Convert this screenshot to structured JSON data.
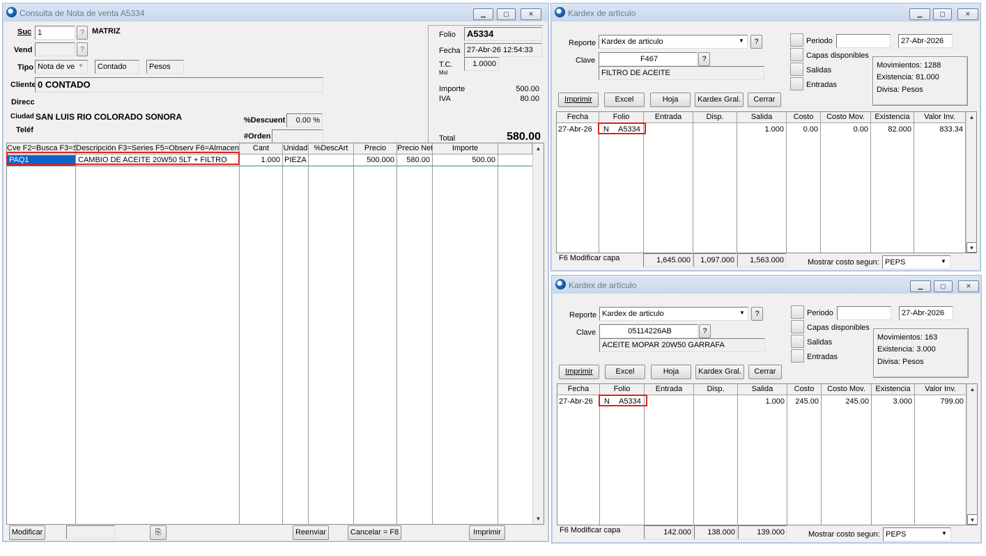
{
  "venta": {
    "title": "Consulta de Nota de venta A5334",
    "suc_label": "Suc",
    "suc_value": "1",
    "suc_name": "MATRIZ",
    "vend_label": "Vend",
    "tipo_label": "Tipo",
    "tipo_value": "Nota de ve",
    "tipo_contado": "Contado",
    "tipo_moneda": "Pesos",
    "cliente_label": "Cliente",
    "cliente_value": "0 CONTADO",
    "direcc_label": "Direcc",
    "ciudad_label": "Ciudad",
    "ciudad_value": "SAN LUIS RIO COLORADO SONORA",
    "telef_label": "Teléf",
    "descuent_label": "%Descuent",
    "descuent_value": "0.00 %",
    "orden_label": "#Orden",
    "folio_label": "Folio",
    "folio_value": "A5334",
    "fecha_label": "Fecha",
    "fecha_value": "27-Abr-26 12:54:33",
    "tc_label": "T.C.",
    "tc_sub": "Msl",
    "tc_value": "1.0000",
    "importe_label": "Importe",
    "importe_value": "500.00",
    "iva_label": "IVA",
    "iva_value": "80.00",
    "total_label": "Total",
    "total_value": "580.00",
    "help": "?",
    "columns": [
      "Cve F2=Busca F3=S",
      "Descripción  F3=Series F5=Observ F6=Almacen",
      "Cant",
      "Unidad",
      "%DescArt",
      "Precio",
      "Precio Net",
      "Importe"
    ],
    "row": {
      "cve": "PAQ1",
      "desc": "CAMBIO DE ACEITE 20W50 5LT + FILTRO",
      "cant": "1.000",
      "unidad": "PIEZA",
      "desc_art": "",
      "precio": "500.000",
      "precio_net": "580.00",
      "importe": "500.00"
    },
    "btn_modificar": "Modificar",
    "btn_reenviar": "Reenviar",
    "btn_cancelar": "Cancelar = F8",
    "btn_imprimir": "Imprimir"
  },
  "kardex": [
    {
      "title": "Kardex de artículo",
      "reporte_label": "Reporte",
      "reporte_value": "Kardex de articulo",
      "clave_label": "Clave",
      "clave_value": "F467",
      "descripcion": "FILTRO DE ACEITE",
      "periodo_label": "Periodo",
      "periodo_date": "27-Abr-2026",
      "capas_label": "Capas disponibles",
      "salidas_label": "Salidas",
      "entradas_label": "Entradas",
      "movimientos": "Movimientos:   1288",
      "existencia": "Existencia: 81.000",
      "divisa": "Divisa: Pesos",
      "btn_imprimir": "Imprimir",
      "btn_excel": "Excel",
      "btn_hoja": "Hoja",
      "btn_kardex": "Kardex Gral.",
      "btn_cerrar": "Cerrar",
      "columns": [
        "Fecha",
        "Folio",
        "Entrada",
        "Disp.",
        "Salida",
        "Costo",
        "Costo Mov.",
        "Existencia",
        "Valor Inv."
      ],
      "row": {
        "fecha": "27-Abr-26",
        "tipo": "N",
        "folio": "A5334",
        "entrada": "",
        "disp": "",
        "salida": "1.000",
        "costo": "0.00",
        "costo_mov": "0.00",
        "existencia": "82.000",
        "valor": "833.34"
      },
      "f6_label": "F6 Modificar capa",
      "tot_entrada": "1,645.000",
      "tot_disp": "1,097.000",
      "tot_salida": "1,563.000",
      "mostrar_label": "Mostrar costo segun:",
      "mostrar_value": "PEPS"
    },
    {
      "title": "Kardex de artículo",
      "reporte_label": "Reporte",
      "reporte_value": "Kardex de articulo",
      "clave_label": "Clave",
      "clave_value": "05114226AB",
      "descripcion": "ACEITE MOPAR 20W50 GARRAFA",
      "periodo_label": "Periodo",
      "periodo_date": "27-Abr-2026",
      "capas_label": "Capas disponibles",
      "salidas_label": "Salidas",
      "entradas_label": "Entradas",
      "movimientos": "Movimientos:   163",
      "existencia": "Existencia: 3.000",
      "divisa": "Divisa: Pesos",
      "btn_imprimir": "Imprimir",
      "btn_excel": "Excel",
      "btn_hoja": "Hoja",
      "btn_kardex": "Kardex Gral.",
      "btn_cerrar": "Cerrar",
      "columns": [
        "Fecha",
        "Folio",
        "Entrada",
        "Disp.",
        "Salida",
        "Costo",
        "Costo Mov.",
        "Existencia",
        "Valor Inv."
      ],
      "row": {
        "fecha": "27-Abr-26",
        "tipo": "N",
        "folio": "A5334",
        "entrada": "",
        "disp": "",
        "salida": "1.000",
        "costo": "245.00",
        "costo_mov": "245.00",
        "existencia": "3.000",
        "valor": "799.00"
      },
      "f6_label": "F6 Modificar capa",
      "tot_entrada": "142.000",
      "tot_disp": "138.000",
      "tot_salida": "139.000",
      "mostrar_label": "Mostrar costo segun:",
      "mostrar_value": "PEPS"
    }
  ]
}
